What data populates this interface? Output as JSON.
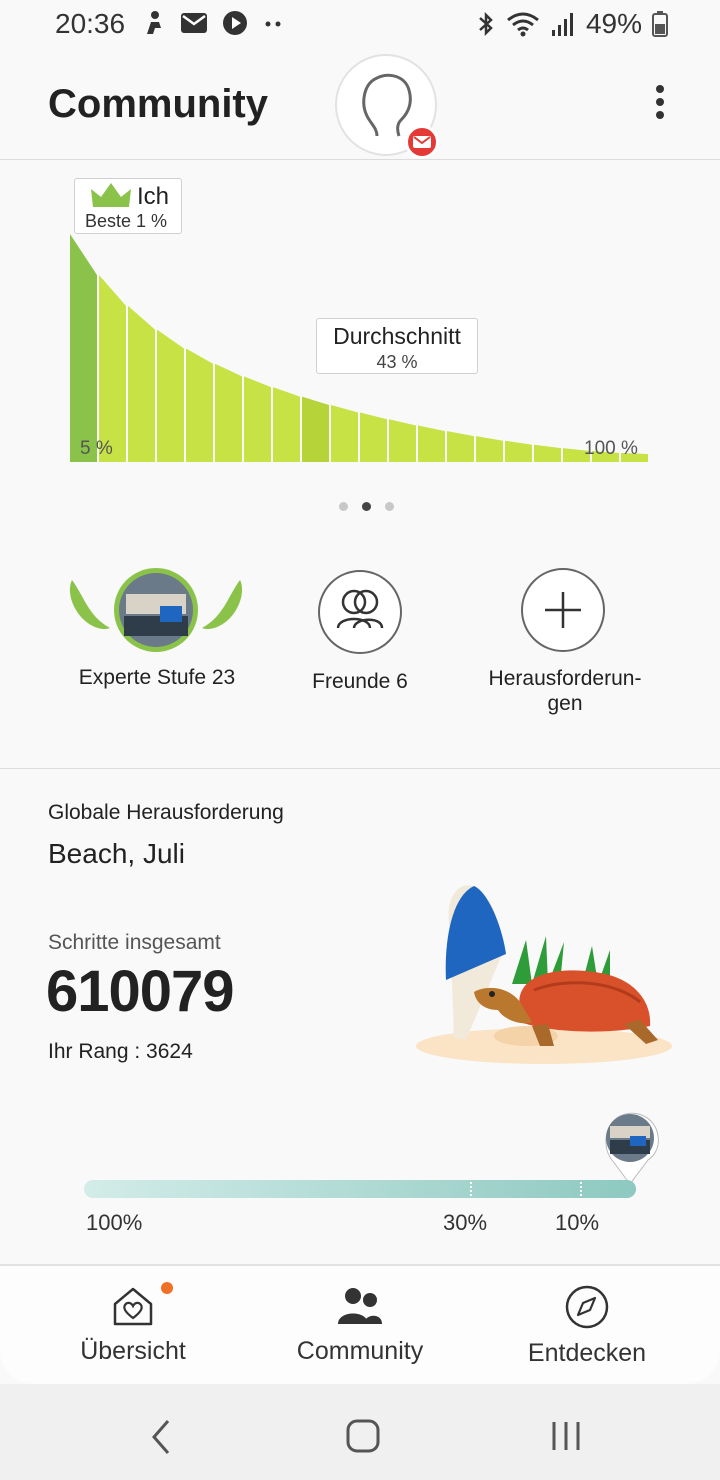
{
  "status_bar": {
    "time": "20:36",
    "battery": "49%"
  },
  "header": {
    "title": "Community"
  },
  "ranking_chart": {
    "me_label": "Ich",
    "me_sub": "Beste 1 %",
    "avg_label": "Durchschnitt",
    "avg_sub": "43 %",
    "left_label": "5 %",
    "right_label": "100 %",
    "accent_color": "#8bc34a",
    "bar_color": "#c6e244"
  },
  "pager": {
    "count": 3,
    "active_index": 1
  },
  "shortcuts": {
    "level": "Experte Stufe 23",
    "friends": "Freunde 6",
    "challenges_line1": "Herausforderun-",
    "challenges_line2": "gen"
  },
  "global_challenge": {
    "label": "Globale Herausforderung",
    "title": "Beach, Juli",
    "steps_label": "Schritte insgesamt",
    "steps_value": "610079",
    "rank": "Ihr Rang : 3624",
    "progress_labels": [
      "100%",
      "30%",
      "10%"
    ]
  },
  "bottom_nav": {
    "overview": "Übersicht",
    "community": "Community",
    "discover": "Entdecken"
  }
}
